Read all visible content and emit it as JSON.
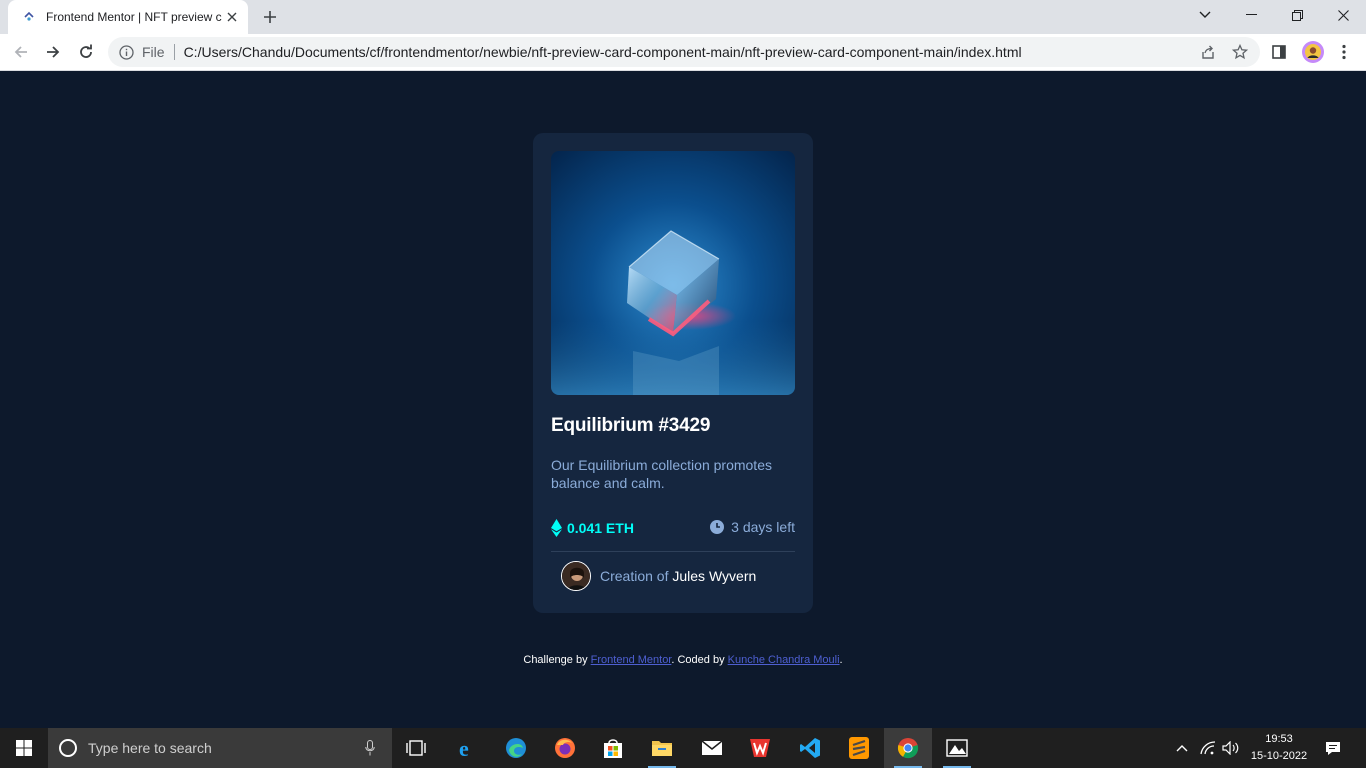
{
  "browser": {
    "tab_title": "Frontend Mentor | NFT preview c",
    "omnibox_scheme": "File",
    "url": "C:/Users/Chandu/Documents/cf/frontendmentor/newbie/nft-preview-card-component-main/nft-preview-card-component-main/index.html"
  },
  "card": {
    "title": "Equilibrium #3429",
    "description": "Our Equilibrium collection promotes balance and calm.",
    "price": "0.041 ETH",
    "time_left": "3 days left",
    "creator_prefix": "Creation of",
    "creator_name": "Jules Wyvern"
  },
  "attribution": {
    "prefix": "Challenge by",
    "link1": "Frontend Mentor",
    "middle": ". Coded by",
    "link2": "Kunche Chandra Mouli",
    "suffix": "."
  },
  "taskbar": {
    "search_placeholder": "Type here to search",
    "time": "19:53",
    "date": "15-10-2022"
  },
  "colors": {
    "page_bg": "#0d192c",
    "card_bg": "#15263f",
    "cyan": "#00fff8",
    "soft_blue": "#8bacd9",
    "link": "#4e5fd1"
  }
}
